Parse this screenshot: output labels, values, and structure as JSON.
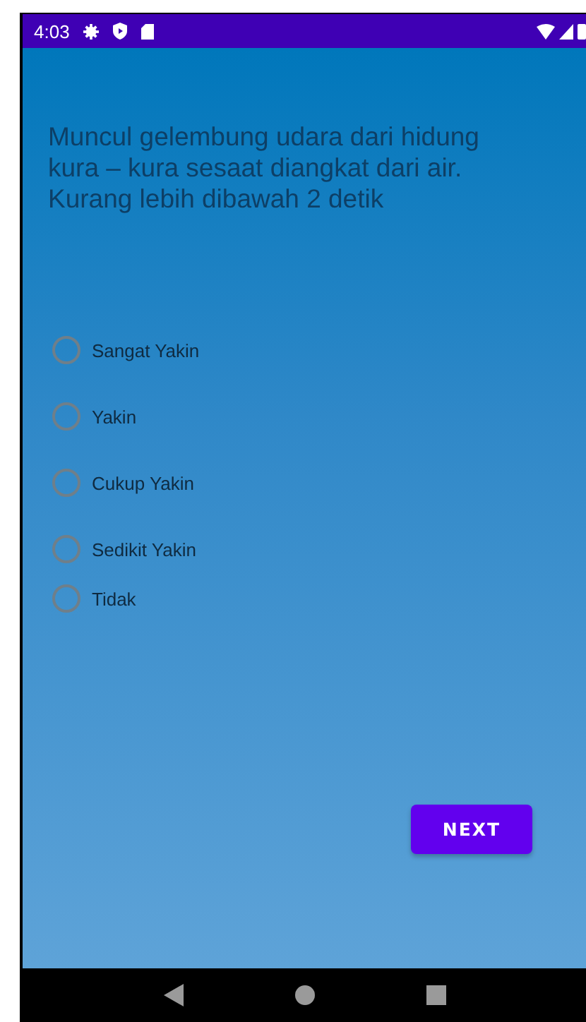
{
  "status_bar": {
    "time": "4:03"
  },
  "question": "Muncul gelembung udara dari hidung kura – kura sesaat diangkat dari air. Kurang lebih dibawah 2 detik",
  "options": [
    {
      "label": "Sangat Yakin",
      "selected": false
    },
    {
      "label": "Yakin",
      "selected": false
    },
    {
      "label": "Cukup Yakin",
      "selected": false
    },
    {
      "label": "Sedikit Yakin",
      "selected": false
    },
    {
      "label": "Tidak",
      "selected": false
    }
  ],
  "next_button": "NEXT"
}
